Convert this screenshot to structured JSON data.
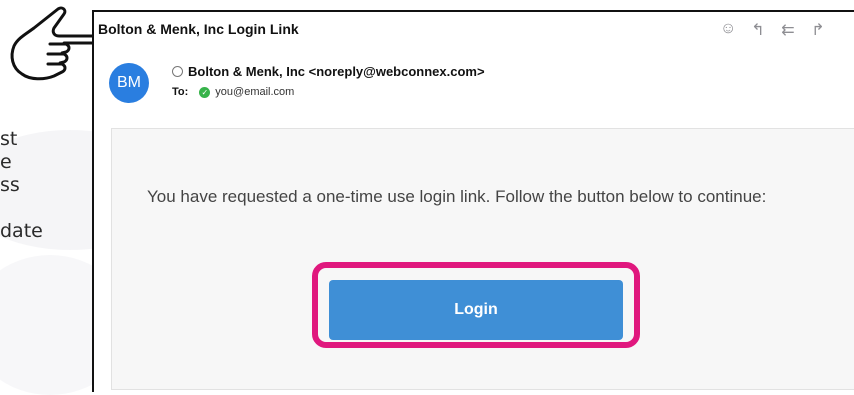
{
  "email": {
    "subject": "Bolton & Menk, Inc Login Link",
    "sender_initials": "BM",
    "from": "Bolton & Menk, Inc <noreply@webconnex.com>",
    "to_label": "To:",
    "to_address": "you@email.com",
    "message": "You have requested a one-time use login link. Follow the button below to continue:",
    "login_button_label": "Login"
  },
  "toolbar": {
    "icons": [
      "smiley-icon",
      "reply-icon",
      "reply-all-icon",
      "forward-icon"
    ]
  },
  "side_text": [
    "st",
    "e",
    "ss",
    "date"
  ],
  "colors": {
    "highlight": "#e0187e",
    "button": "#3f8fd6",
    "avatar": "#2a7ee0",
    "verified": "#37b34a"
  }
}
